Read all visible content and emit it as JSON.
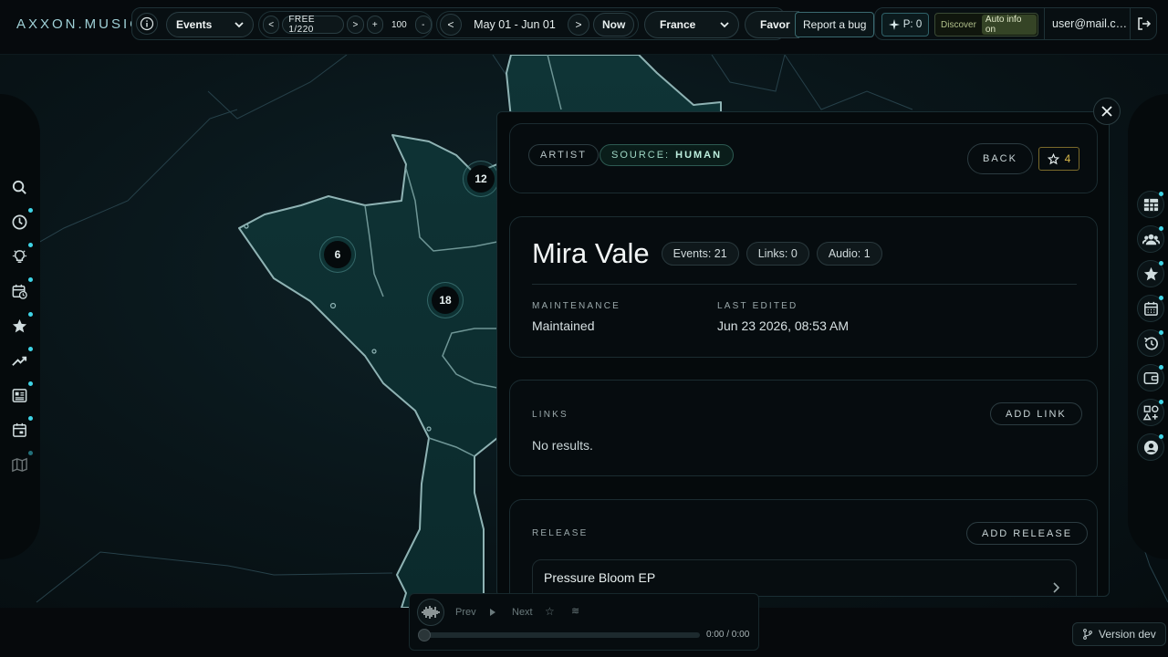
{
  "app": {
    "brand": "AXXON.MUSIC"
  },
  "topbar": {
    "view_select": "Events",
    "page_prev": "<",
    "page_label": "FREE 1/220",
    "page_next": ">",
    "zoom_plus": "+",
    "zoom_value": "100",
    "zoom_minus": "-",
    "date_prev": "<",
    "date_range": "May 01 - Jun 01",
    "date_next": ">",
    "now_label": "Now",
    "country_select": "France",
    "favorites_label": "Favor",
    "report_bug": "Report a bug",
    "points_label": "P: 0",
    "discover_label": "Discover",
    "auto_info_label": "Auto info on",
    "user_email": "user@mail.c…"
  },
  "map": {
    "clusters": [
      {
        "count": "12"
      },
      {
        "count": "6"
      },
      {
        "count": "18"
      }
    ]
  },
  "panel": {
    "tags": {
      "type": "ARTIST",
      "source_prefix": "SOURCE:",
      "source_value": "HUMAN"
    },
    "back_label": "BACK",
    "favorite_count": "4",
    "artist_name": "Mira Vale",
    "chips": {
      "events": "Events: 21",
      "links": "Links: 0",
      "audio": "Audio: 1"
    },
    "maintenance_label": "MAINTENANCE",
    "maintenance_value": "Maintained",
    "last_edited_label": "LAST EDITED",
    "last_edited_value": "Jun 23 2026, 08:53 AM",
    "links_heading": "LINKS",
    "add_link_label": "ADD LINK",
    "links_empty": "No results.",
    "release_heading": "RELEASE",
    "add_release_label": "ADD RELEASE",
    "releases": [
      {
        "title": "Pressure Bloom EP"
      }
    ]
  },
  "player": {
    "prev_label": "Prev",
    "next_label": "Next",
    "time": "0:00 / 0:00",
    "progress": 0
  },
  "footer": {
    "version_label": "Version dev"
  },
  "colors": {
    "accent": "#3fd4e6",
    "background": "#06090c",
    "panel_border": "#1a2e33"
  }
}
